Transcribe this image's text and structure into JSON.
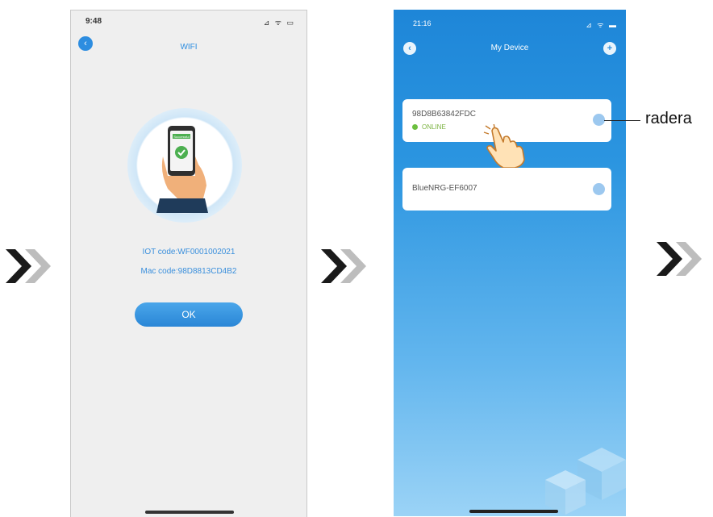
{
  "screen1": {
    "time": "9:48",
    "status_icons": "⊿ ᯤ ▭",
    "back_icon": "back-arrow-icon",
    "title": "WIFI",
    "illustration_caption": "Successful",
    "iot_code": "IOT code:WF0001002021",
    "mac_code": "Mac code:98D8813CD4B2",
    "ok_label": "OK"
  },
  "screen2": {
    "time": "21:16",
    "status_icons": "⊿ ᯤ ▬",
    "back_icon": "back-arrow-icon",
    "title": "My Device",
    "add_icon": "plus-icon",
    "devices": [
      {
        "name": "98D8B63842FDC",
        "status": "ONLINE"
      },
      {
        "name": "BlueNRG-EF6007"
      }
    ]
  },
  "annotation": {
    "label": "radera"
  },
  "colors": {
    "accent": "#2d8de0",
    "online": "#6cbf3f",
    "arrow_dark": "#1a1a1a",
    "arrow_light": "#bdbdbd"
  }
}
